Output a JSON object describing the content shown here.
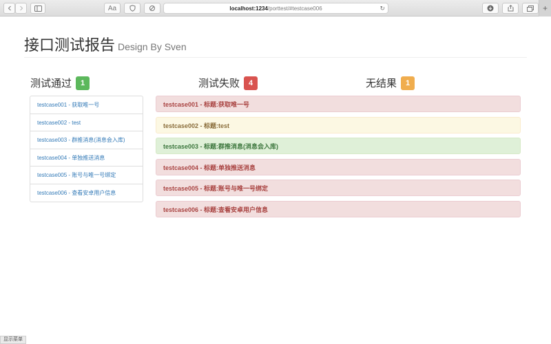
{
  "browser": {
    "host": "localhost:1234",
    "path": "/porttest/#testcase006",
    "translate_label": "Aa"
  },
  "header": {
    "title": "接口测试报告",
    "subtitle": "Design By Sven"
  },
  "columns": {
    "passed": {
      "label": "测试通过",
      "count": "1"
    },
    "failed": {
      "label": "测试失败",
      "count": "4"
    },
    "noresult": {
      "label": "无结果",
      "count": "1"
    }
  },
  "testcases": [
    "testcase001 - 获取唯一号",
    "testcase002 - test",
    "testcase003 - 群推消息(消息会入库)",
    "testcase004 - 单独推送消息",
    "testcase005 - 账号与唯一号绑定",
    "testcase006 - 查看安卓用户信息"
  ],
  "results": [
    {
      "text": "testcase001 - 标题:获取唯一号",
      "status": "danger"
    },
    {
      "text": "testcase002 - 标题:test",
      "status": "warning"
    },
    {
      "text": "testcase003 - 标题:群推消息(消息会入库)",
      "status": "success"
    },
    {
      "text": "testcase004 - 标题:单独推送消息",
      "status": "danger"
    },
    {
      "text": "testcase005 - 标题:账号与唯一号绑定",
      "status": "danger"
    },
    {
      "text": "testcase006 - 标题:查看安卓用户信息",
      "status": "danger"
    }
  ],
  "status_bar": "显示菜单",
  "colors": {
    "success": "#5cb85c",
    "danger": "#d9534f",
    "warning": "#f0ad4e",
    "link": "#337ab7"
  }
}
